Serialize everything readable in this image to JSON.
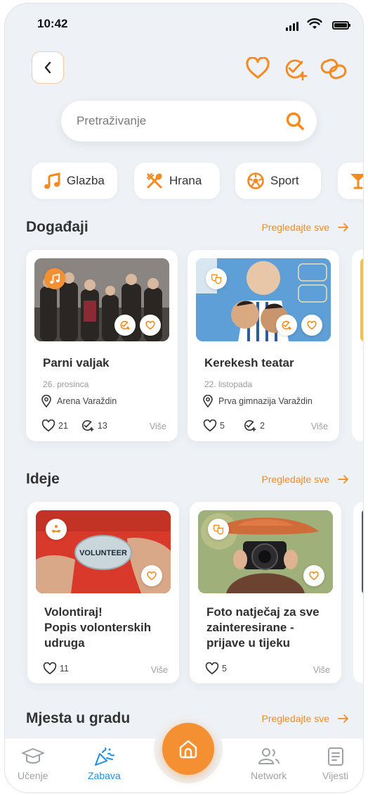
{
  "status": {
    "time": "10:42"
  },
  "search": {
    "placeholder": "Pretraživanje"
  },
  "categories": [
    {
      "label": "Glazba",
      "icon": "music-icon"
    },
    {
      "label": "Hrana",
      "icon": "fork-spoon-icon"
    },
    {
      "label": "Sport",
      "icon": "ball-icon"
    },
    {
      "label": "",
      "icon": "cocktail-icon"
    }
  ],
  "events": {
    "title": "Događaji",
    "see_all": "Pregledajte sve",
    "items": [
      {
        "title": "Parni valjak",
        "date": "26. prosinca",
        "location": "Arena Varaždin",
        "likes": "21",
        "going": "13",
        "more": "Više"
      },
      {
        "title": "Kerekesh teatar",
        "date": "22. listopada",
        "location": "Prva gimnazija Varaždin",
        "likes": "5",
        "going": "2",
        "more": "Više"
      }
    ]
  },
  "ideas": {
    "title": "Ideje",
    "see_all": "Pregledajte sve",
    "items": [
      {
        "title_lines": [
          "Volontiraj!",
          "Popis volonterskih",
          "udruga"
        ],
        "likes": "11",
        "more": "Više",
        "image_text": "VOLUNTEER"
      },
      {
        "title_lines": [
          "Foto natječaj za sve",
          "zainteresirane -",
          "prijave u tijeku"
        ],
        "likes": "5",
        "more": "Više"
      }
    ]
  },
  "places": {
    "title": "Mjesta u gradu",
    "see_all": "Pregledajte sve"
  },
  "nav": [
    {
      "label": "Učenje",
      "icon": "graduation-cap-icon"
    },
    {
      "label": "Zabava",
      "icon": "party-popper-icon"
    },
    {
      "label": "Network",
      "icon": "people-icon"
    },
    {
      "label": "Vijesti",
      "icon": "news-icon"
    }
  ],
  "colors": {
    "accent": "#f58a1f",
    "background": "#eef1f5",
    "inactive": "#9ea2a8"
  }
}
